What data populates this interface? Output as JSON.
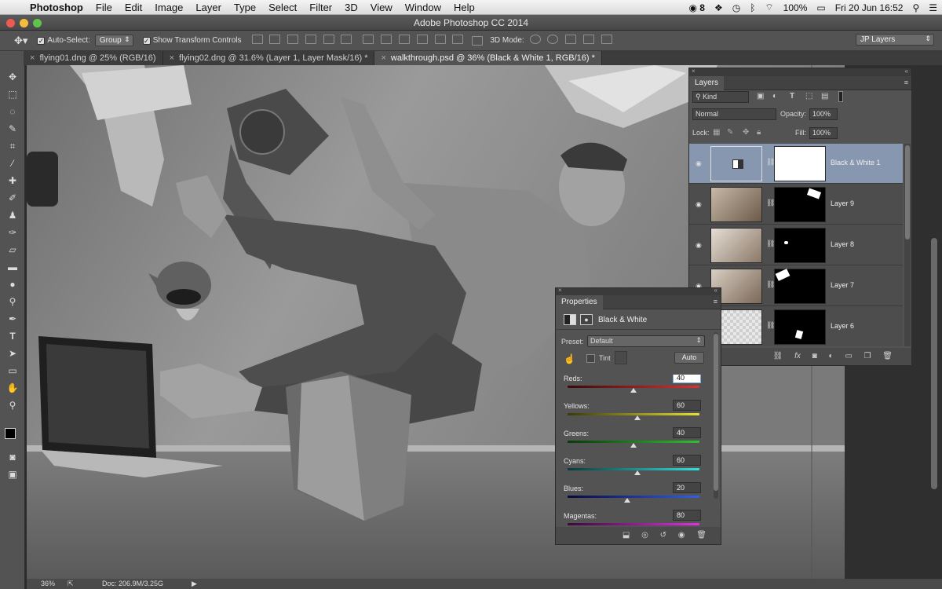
{
  "menubar": {
    "app_name": "Photoshop",
    "items": [
      "File",
      "Edit",
      "Image",
      "Layer",
      "Type",
      "Select",
      "Filter",
      "3D",
      "View",
      "Window",
      "Help"
    ],
    "status": {
      "cc_badge": "8",
      "battery": "100%",
      "datetime": "Fri 20 Jun  16:52"
    }
  },
  "window": {
    "title": "Adobe Photoshop CC 2014"
  },
  "options": {
    "auto_select_label": "Auto-Select:",
    "auto_select_value": "Group",
    "show_transform_label": "Show Transform Controls",
    "mode_3d_label": "3D Mode:",
    "workspace": "JP Layers"
  },
  "tabs": [
    {
      "label": "flying01.dng @ 25% (RGB/16)"
    },
    {
      "label": "flying02.dng @ 31.6% (Layer 1, Layer Mask/16) *"
    },
    {
      "label": "walkthrough.psd @ 36% (Black & White 1, RGB/16) *"
    }
  ],
  "status": {
    "zoom": "36%",
    "doc": "Doc: 206.9M/3.25G"
  },
  "layers_panel": {
    "tab_label": "Layers",
    "filter_kind": "Kind",
    "blend_mode": "Normal",
    "opacity_label": "Opacity:",
    "opacity_value": "100%",
    "lock_label": "Lock:",
    "fill_label": "Fill:",
    "fill_value": "100%",
    "layers": [
      {
        "name": "Black & White 1"
      },
      {
        "name": "Layer 9"
      },
      {
        "name": "Layer 8"
      },
      {
        "name": "Layer 7"
      },
      {
        "name": "Layer 6"
      }
    ]
  },
  "properties_panel": {
    "tab_label": "Properties",
    "adjustment_name": "Black & White",
    "preset_label": "Preset:",
    "preset_value": "Default",
    "tint_label": "Tint",
    "auto_label": "Auto",
    "sliders": [
      {
        "label": "Reds:",
        "value": "40",
        "position": 0.5,
        "gradient": "linear-gradient(90deg,#3a0a0a,#e23030)"
      },
      {
        "label": "Yellows:",
        "value": "60",
        "position": 0.53,
        "gradient": "linear-gradient(90deg,#3a3a0a,#e8e030)"
      },
      {
        "label": "Greens:",
        "value": "40",
        "position": 0.5,
        "gradient": "linear-gradient(90deg,#0a3a0a,#30c030)"
      },
      {
        "label": "Cyans:",
        "value": "60",
        "position": 0.53,
        "gradient": "linear-gradient(90deg,#0a3a3a,#30e0e0)"
      },
      {
        "label": "Blues:",
        "value": "20",
        "position": 0.45,
        "gradient": "linear-gradient(90deg,#0a0a3a,#3060e8)"
      },
      {
        "label": "Magentas:",
        "value": "80",
        "position": 0.58,
        "gradient": "linear-gradient(90deg,#3a0a3a,#e030e0)"
      }
    ]
  }
}
